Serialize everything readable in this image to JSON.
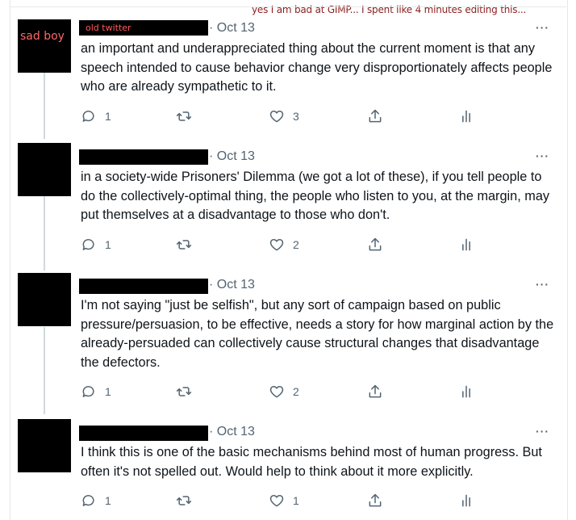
{
  "caption": "yes I am bad at GIMP... I spent like 4 minutes editing this...",
  "tweets": [
    {
      "avatar_text": "sad boy",
      "name_text": "old twitter",
      "date": "· Oct 13",
      "more": "···",
      "text": "an important and underappreciated thing about the current moment is that any speech intended to cause behavior change very disproportionately affects people who are already sympathetic to it.",
      "replies": "1",
      "retweets": "",
      "likes": "3"
    },
    {
      "avatar_text": "",
      "name_text": "",
      "date": "· Oct 13",
      "more": "···",
      "text": "in a society-wide Prisoners' Dilemma (we got a lot of these), if you tell people to do the collectively-optimal thing, the people who listen to you, at the margin, may put themselves at a disadvantage to those who don't.",
      "replies": "1",
      "retweets": "",
      "likes": "2"
    },
    {
      "avatar_text": "",
      "name_text": "",
      "date": "· Oct 13",
      "more": "···",
      "text": "I'm not saying \"just be selfish\", but any sort of campaign based on public pressure/persuasion, to be effective, needs a story for how marginal action by the already-persuaded can collectively cause structural changes that disadvantage the defectors.",
      "replies": "1",
      "retweets": "",
      "likes": "2"
    },
    {
      "avatar_text": "",
      "name_text": "",
      "date": "· Oct 13",
      "more": "···",
      "text": "I think this is one of the basic mechanisms behind most of human progress. But often it's not spelled out. Would help to think about it more explicitly.",
      "replies": "1",
      "retweets": "",
      "likes": "1"
    }
  ],
  "icons": {
    "reply": "reply-icon",
    "retweet": "retweet-icon",
    "like": "like-icon",
    "share": "share-icon",
    "analytics": "analytics-icon",
    "more": "more-icon"
  },
  "colors": {
    "caption": "#8b1e1e",
    "secondary_text": "#536471",
    "primary_text": "#0f1419",
    "redaction": "#000000",
    "thread_line": "#cfd9de"
  }
}
